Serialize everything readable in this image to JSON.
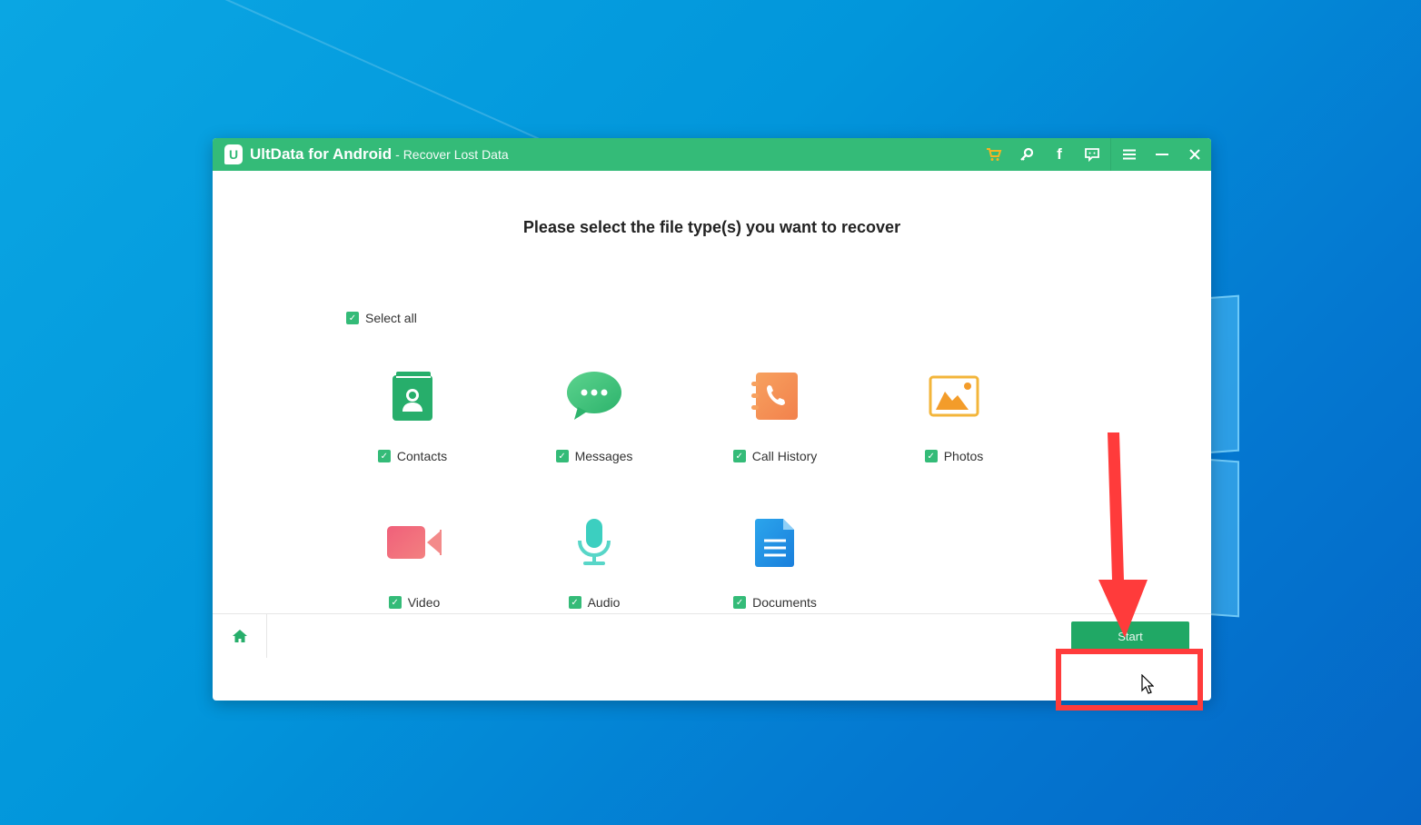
{
  "window": {
    "app_name": "UltData for Android",
    "subtitle": "- Recover Lost Data",
    "logo_letter": "U",
    "title_icons": [
      {
        "name": "cart-icon",
        "glyph": "🛒"
      },
      {
        "name": "key-icon",
        "glyph": "⚷"
      },
      {
        "name": "facebook-icon",
        "glyph": "f"
      },
      {
        "name": "feedback-icon",
        "glyph": "💬"
      },
      {
        "name": "menu-icon",
        "glyph": "≡"
      },
      {
        "name": "minimize-icon",
        "glyph": "—"
      },
      {
        "name": "close-icon",
        "glyph": "✕"
      }
    ]
  },
  "main": {
    "heading": "Please select the file type(s) you want to recover",
    "select_all": {
      "label": "Select all",
      "checked": true
    },
    "file_types": [
      {
        "id": "contacts",
        "label": "Contacts",
        "checked": true
      },
      {
        "id": "messages",
        "label": "Messages",
        "checked": true
      },
      {
        "id": "call-history",
        "label": "Call History",
        "checked": true
      },
      {
        "id": "photos",
        "label": "Photos",
        "checked": true
      },
      {
        "id": "video",
        "label": "Video",
        "checked": true
      },
      {
        "id": "audio",
        "label": "Audio",
        "checked": true
      },
      {
        "id": "documents",
        "label": "Documents",
        "checked": true
      }
    ]
  },
  "footer": {
    "start_label": "Start"
  },
  "check_glyph": "✓",
  "colors": {
    "brand_green": "#34bb78",
    "start_green": "#20a865",
    "annotation_red": "#ff3b3b"
  }
}
